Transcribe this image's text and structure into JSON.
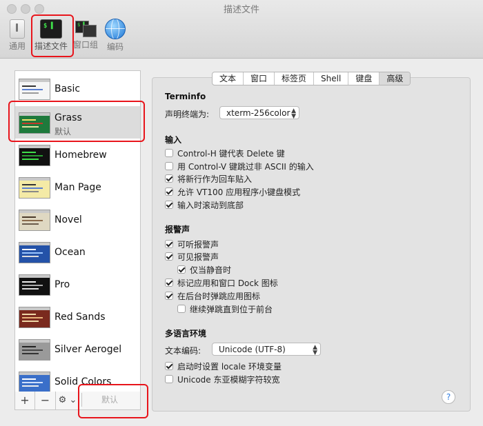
{
  "window": {
    "title": "描述文件"
  },
  "toolbar": {
    "items": [
      {
        "label": "通用"
      },
      {
        "label": "描述文件",
        "icon_text": "$ ▌"
      },
      {
        "label": "窗口组",
        "icon_text": "$ ▌"
      },
      {
        "label": "编码"
      }
    ]
  },
  "profiles": [
    {
      "name": "Basic",
      "subtitle": ""
    },
    {
      "name": "Grass",
      "subtitle": "默认"
    },
    {
      "name": "Homebrew",
      "subtitle": ""
    },
    {
      "name": "Man Page",
      "subtitle": ""
    },
    {
      "name": "Novel",
      "subtitle": ""
    },
    {
      "name": "Ocean",
      "subtitle": ""
    },
    {
      "name": "Pro",
      "subtitle": ""
    },
    {
      "name": "Red Sands",
      "subtitle": ""
    },
    {
      "name": "Silver Aerogel",
      "subtitle": ""
    },
    {
      "name": "Solid Colors",
      "subtitle": ""
    }
  ],
  "profile_colors": {
    "Basic": "#f5f5f5",
    "Grass": "#1f7a3c",
    "Homebrew": "#111111",
    "Man Page": "#f4eaa6",
    "Novel": "#dfd8c2",
    "Ocean": "#2452a8",
    "Pro": "#111111",
    "Red Sands": "#7a2a1e",
    "Silver Aerogel": "#9a9a9a",
    "Solid Colors": "#3a6fc9"
  },
  "sidebar_bar": {
    "add": "+",
    "remove": "−",
    "gear": "⚙︎ ⌄",
    "default_button": "默认"
  },
  "tabs": [
    {
      "label": "文本"
    },
    {
      "label": "窗口"
    },
    {
      "label": "标签页"
    },
    {
      "label": "Shell"
    },
    {
      "label": "键盘"
    },
    {
      "label": "高级",
      "active": true
    }
  ],
  "terminfo": {
    "heading": "Terminfo",
    "declare_label": "声明终端为:",
    "declare_value": "xterm-256color"
  },
  "input": {
    "heading": "输入",
    "options": [
      {
        "label": "Control-H 键代表 Delete 键",
        "checked": false
      },
      {
        "label": "用 Control-V 键跳过非 ASCII 的输入",
        "checked": false
      },
      {
        "label": "将新行作为回车贴入",
        "checked": true
      },
      {
        "label": "允许 VT100 应用程序小键盘模式",
        "checked": true
      },
      {
        "label": "输入时滚动到底部",
        "checked": true
      }
    ]
  },
  "bell": {
    "heading": "报警声",
    "options": [
      {
        "label": "可听报警声",
        "checked": true
      },
      {
        "label": "可见报警声",
        "checked": true
      },
      {
        "label": "仅当静音时",
        "checked": true
      },
      {
        "label": "标记应用和窗口 Dock 图标",
        "checked": true
      },
      {
        "label": "在后台时弹跳应用图标",
        "checked": true
      },
      {
        "label": "继续弹跳直到位于前台",
        "checked": false
      }
    ]
  },
  "international": {
    "heading": "多语言环境",
    "encoding_label": "文本编码:",
    "encoding_value": "Unicode (UTF-8)",
    "options": [
      {
        "label": "启动时设置 locale 环境变量",
        "checked": true
      },
      {
        "label": "Unicode 东亚模糊字符较宽",
        "checked": false
      }
    ]
  },
  "help": "?"
}
